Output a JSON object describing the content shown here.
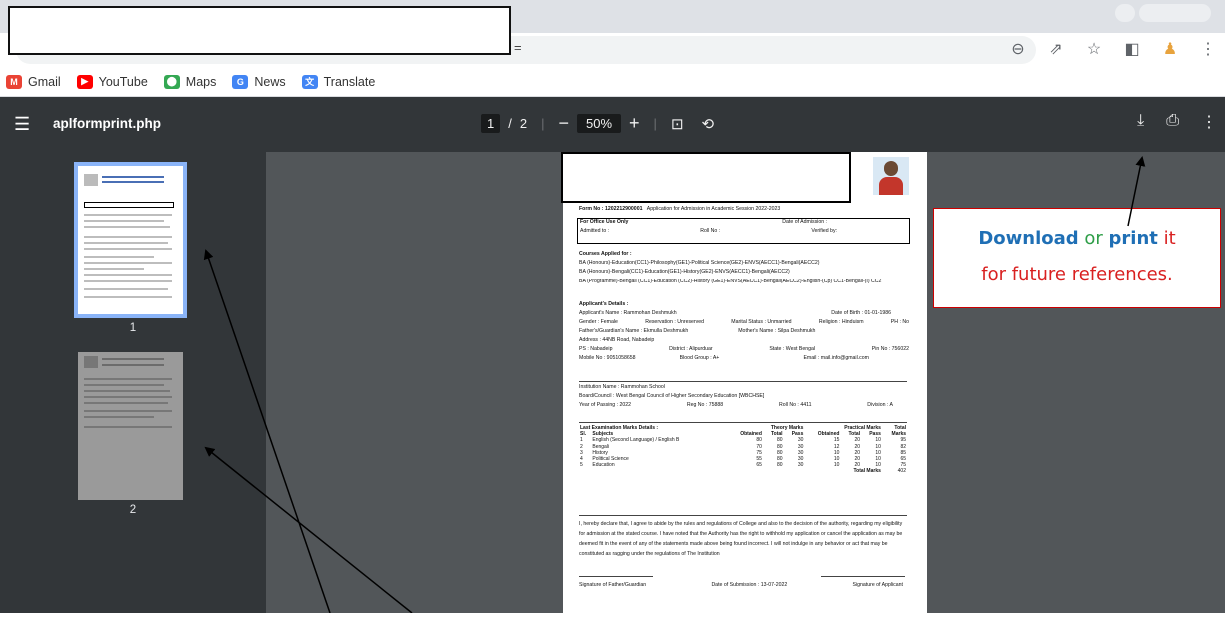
{
  "browser": {
    "url_tail": "=",
    "toolbar_icons": [
      "zoom-icon",
      "share-icon",
      "star-icon",
      "sidebar-icon",
      "extension-icon",
      "menu-dots-icon"
    ]
  },
  "bookmarks": [
    {
      "label": "Gmail",
      "icon": "gmail-icon",
      "color": "#ea4335"
    },
    {
      "label": "YouTube",
      "icon": "youtube-icon",
      "color": "#ff0000"
    },
    {
      "label": "Maps",
      "icon": "maps-icon",
      "color": "#34a853"
    },
    {
      "label": "News",
      "icon": "news-icon",
      "color": "#4285f4"
    },
    {
      "label": "Translate",
      "icon": "translate-icon",
      "color": "#4285f4"
    }
  ],
  "pdf": {
    "filename": "aplformprint.php",
    "page_current": "1",
    "page_sep": "/",
    "page_total": "2",
    "zoom": "50%",
    "zoom_out": "−",
    "zoom_in": "+",
    "thumbs": [
      {
        "label": "1"
      },
      {
        "label": "2"
      }
    ]
  },
  "form": {
    "form_no_label": "Form No :",
    "form_no": "1202212900001",
    "form_heading": "Application for Admission in Academic Session 2022-2023",
    "office_title": "For Office Use Only",
    "date_admission": "Date of Admission :",
    "admitted_to": "Admitted to :",
    "roll_no": "Roll No :",
    "verified_by": "Verified by:",
    "courses_title": "Courses Applied for :",
    "courses": [
      "BA (Honours)-Education(CC1)-Philosophy(GE1)-Political Science(GE2)-ENVS(AECC1)-Bengali(AECC2)",
      "BA (Honours)-Bengali(CC1)-Education(GE1)-History(GE2)-ENVS(AECC1)-Bengali(AECC2)",
      "BA (Programme)-Bengali (CC1)-Education (CC2)-History (GE1)-ENVS(AECC1)-Bengali(AECC2)-English-(Cp) CC1-Bengali-(I) CC2"
    ],
    "app_details_title": "Applicant's Details :",
    "name": "Applicant's Name : Rammohan Deshmukh",
    "dob": "Date of Birth : 01-01-1986",
    "gender": "Gender : Female",
    "reservation": "Reservation : Unreserved",
    "marital": "Marital Status : Unmarried",
    "religion": "Religion : Hinduism",
    "ph": "PH : No",
    "father": "Father's/Guardian's Name : Ekmulla Deshmukh",
    "mother": "Mother's Name : Silpa Deshmukh",
    "address": "Address : 44NB Road, Nabadeip",
    "ps": "PS : Nabadeip",
    "district": "District : Alipurduar",
    "state": "State : West Bengal",
    "pin": "Pin No : 756022",
    "mobile": "Mobile No : 9051058658",
    "blood": "Blood Group : A+",
    "email": "Email : mail.info@gmail.com",
    "institution": "Institution Name : Rammohan School",
    "board": "Board/Council : West Bengal Council of Higher Secondary Education [WBCHSE]",
    "year_passing": "Year of Passing : 2022",
    "reg_no": "Reg No : 75888",
    "roll": "Roll No : 4411",
    "division": "Division : A",
    "marks_title": "Last Examination Marks Details :",
    "theory_head": "Theory Marks",
    "practical_head": "Practical Marks",
    "total_head": "Total",
    "cols": [
      "Sl.",
      "Subjects",
      "Obtained",
      "Total",
      "Pass",
      "Obtained",
      "Total",
      "Pass",
      "Marks"
    ],
    "rows": [
      [
        "1",
        "English (Second Language) / English B",
        "80",
        "80",
        "30",
        "15",
        "20",
        "10",
        "95"
      ],
      [
        "2",
        "Bengali",
        "70",
        "80",
        "30",
        "12",
        "20",
        "10",
        "82"
      ],
      [
        "3",
        "History",
        "75",
        "80",
        "30",
        "10",
        "20",
        "10",
        "85"
      ],
      [
        "4",
        "Political Science",
        "55",
        "80",
        "30",
        "10",
        "20",
        "10",
        "65"
      ],
      [
        "5",
        "Education",
        "65",
        "80",
        "30",
        "10",
        "20",
        "10",
        "75"
      ]
    ],
    "total_marks_label": "Total Marks",
    "total_marks": "402",
    "declaration": "I, hereby declare that, I agree to abide by the rules and regulations of College and also to the decision of the authority, regarding my eligibility for admission at the stated course. I have noted that the Authority has the right to withhold my application or cancel the application as may be deemed fit in the event of any of the statements made above being found incorrect. I will not indulge in any behavior or act that may be constituted as ragging under the regulations of The Institution",
    "sig_guardian": "Signature of Father/Guardian",
    "date_submission": "Date of Submission : 13-07-2022",
    "sig_applicant": "Signature of Applicant"
  },
  "callout": {
    "w1": "Download",
    "w2": "or",
    "w3": "print",
    "w4": "it",
    "line2": "for future references."
  }
}
